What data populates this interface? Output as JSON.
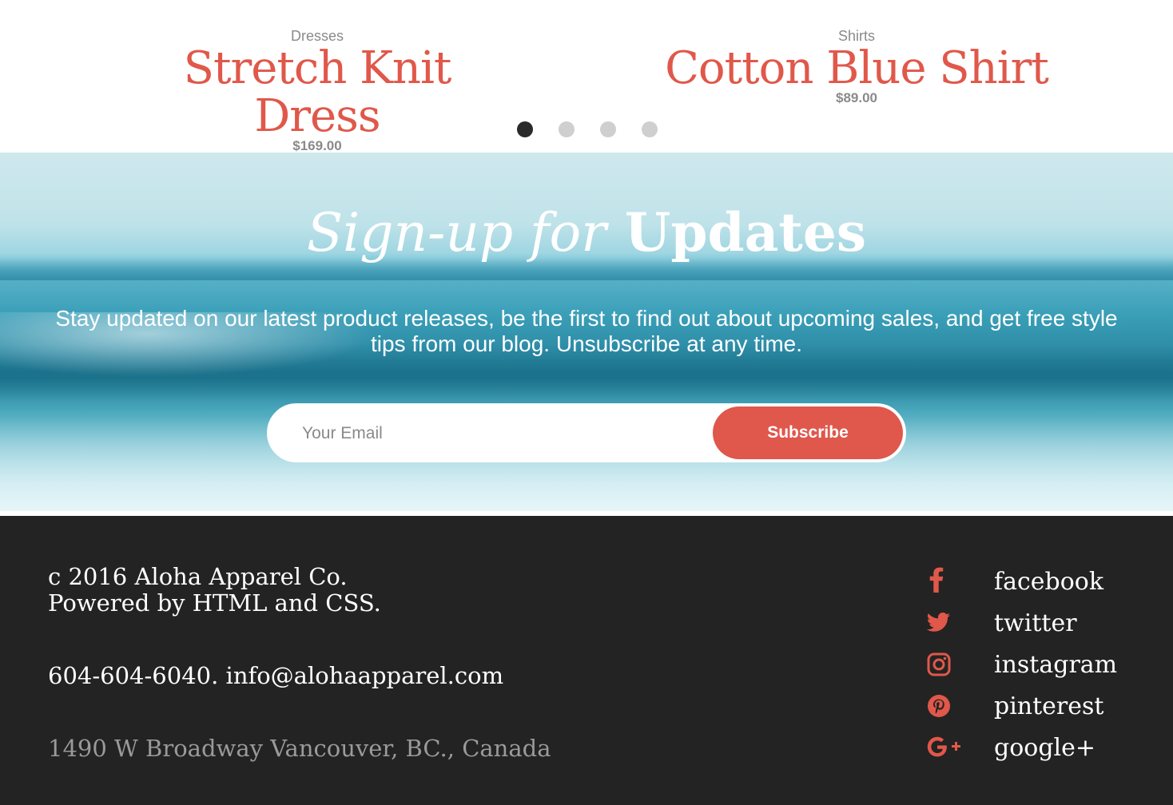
{
  "products": [
    {
      "category": "Dresses",
      "name": "Stretch Knit Dress",
      "price": "$169.00"
    },
    {
      "category": "Shirts",
      "name": "Cotton Blue Shirt",
      "price": "$89.00"
    }
  ],
  "carousel": {
    "total_slides": 4,
    "active_slide": 1
  },
  "signup": {
    "title_light": "Sign-up for",
    "title_bold": "Updates",
    "description": "Stay updated on our latest product releases, be the first to find out about upcoming sales, and get free style tips from our blog. Unsubscribe at any time.",
    "email_placeholder": "Your Email",
    "subscribe_label": "Subscribe"
  },
  "footer": {
    "copyright_line1": "c 2016 Aloha Apparel Co.",
    "copyright_line2": "Powered by HTML and CSS.",
    "contact": "604-604-6040. info@alohaapparel.com",
    "address": "1490 W Broadway Vancouver, BC., Canada",
    "social": [
      {
        "icon": "facebook-icon",
        "label": "facebook"
      },
      {
        "icon": "twitter-icon",
        "label": "twitter"
      },
      {
        "icon": "instagram-icon",
        "label": "instagram"
      },
      {
        "icon": "pinterest-icon",
        "label": "pinterest"
      },
      {
        "icon": "google-plus-icon",
        "label": "google+"
      }
    ]
  },
  "colors": {
    "accent": "#e0584a",
    "footer_bg": "#232323",
    "muted_text": "#8a8a8a",
    "dot_active": "#2a2a2a",
    "dot_inactive": "#cfcfcf"
  }
}
